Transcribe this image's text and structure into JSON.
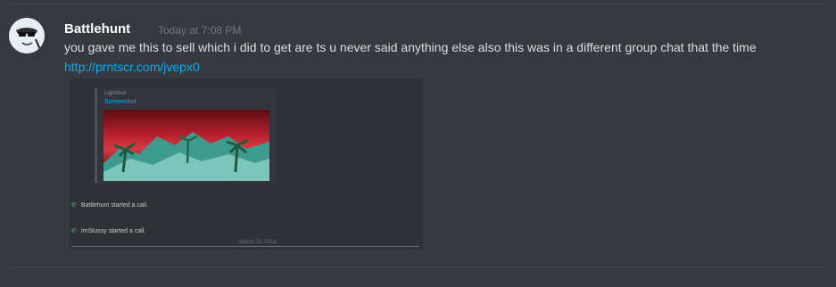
{
  "message": {
    "username": "Battlehunt",
    "timestamp": "Today at 7:08 PM",
    "text": "you gave me this to sell which i did to get are ts u never said anything else also this was in a different group chat that the time",
    "link": "http://prntscr.com/jvepx0"
  },
  "embedded_screenshot": {
    "embed_provider": "Lightshot",
    "embed_title": "Screenshot",
    "calls": [
      {
        "user": "Battlehunt",
        "action": "started a call."
      },
      {
        "user": "ImStussy",
        "action": "started a call."
      }
    ],
    "date_divider": "March 10, 2018"
  },
  "colors": {
    "background": "#36393f",
    "username": "#ffffff",
    "timestamp": "#72767d",
    "text": "#dcddde",
    "link": "#00b0f4",
    "call_icon": "#43b581"
  },
  "icons": {
    "avatar": "cartoon-face-avatar",
    "call": "phone-icon"
  }
}
